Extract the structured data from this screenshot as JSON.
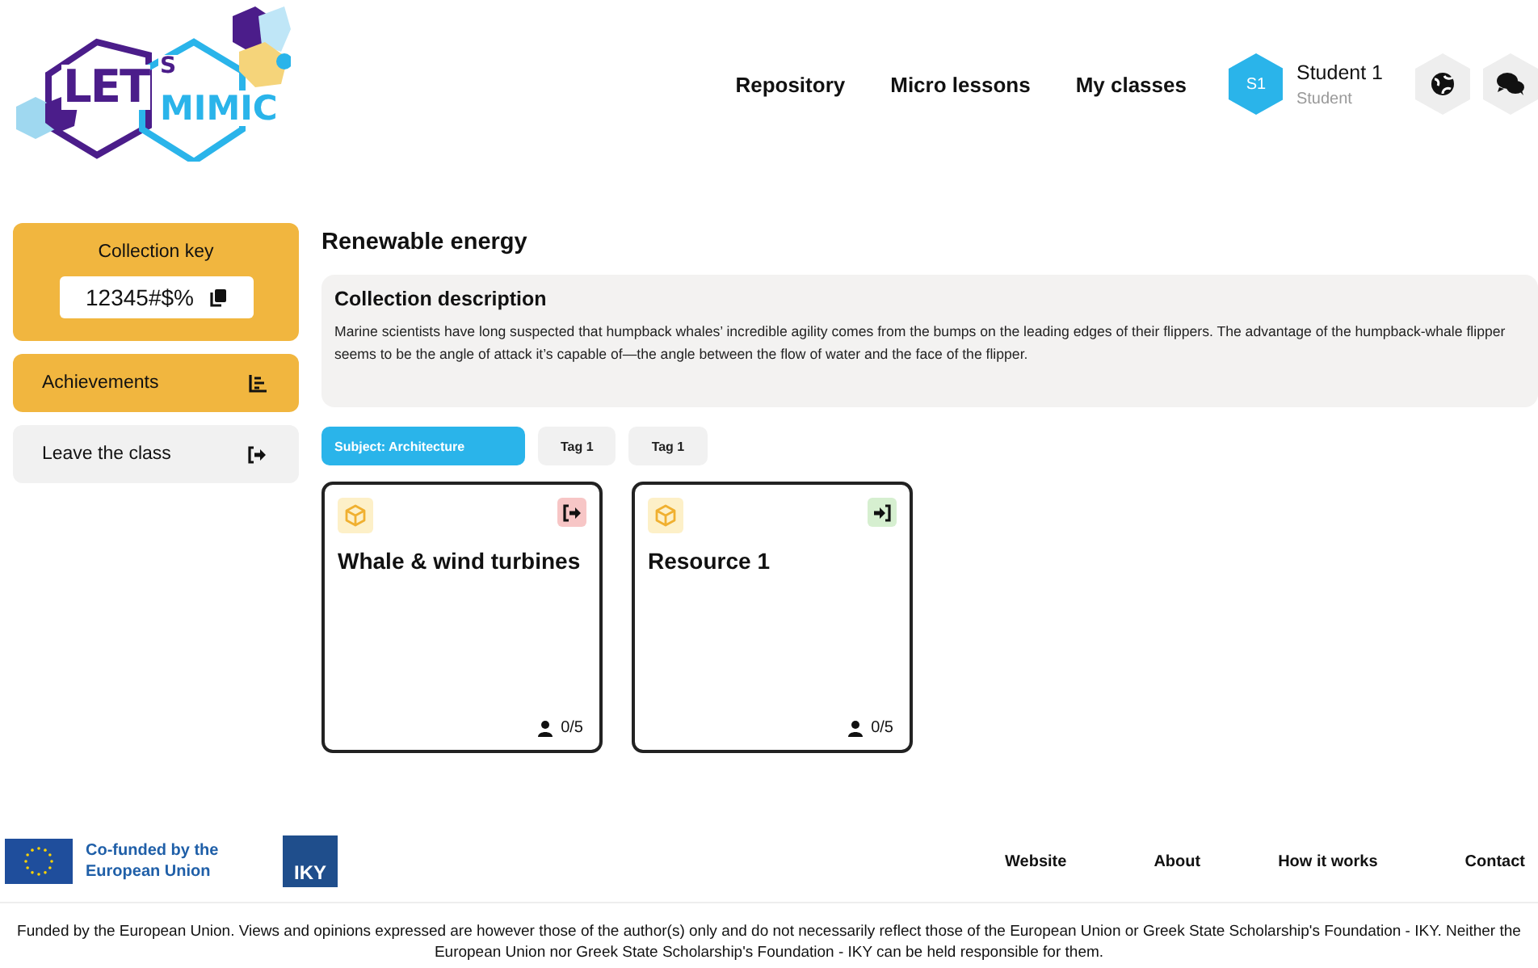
{
  "logo": {
    "word": "LET",
    "mark": "S",
    "word2": "MIMIC"
  },
  "nav": [
    "Repository",
    "Micro lessons",
    "My classes"
  ],
  "user": {
    "initials": "S1",
    "name": "Student 1",
    "role": "Student"
  },
  "sidebar": {
    "key_label": "Collection key",
    "key_value": "12345#$%",
    "items": [
      {
        "label": "Achievements",
        "kind": "chart",
        "selected": true
      },
      {
        "label": "Leave the class",
        "kind": "leave",
        "selected": false
      }
    ]
  },
  "collection": {
    "title": "Renewable energy",
    "description_title": "Collection description",
    "description": "Marine scientists have long suspected that humpback whales’ incredible agility comes from the bumps on the leading edges of their flippers. The advantage of the humpback-whale flipper seems to be the angle of attack it’s capable of—the angle between the flow of water and the face of the flipper.",
    "tags": [
      {
        "label": "Subject: Architecture",
        "selected": true
      },
      {
        "label": "Tag 1",
        "selected": false
      },
      {
        "label": "Tag 1",
        "selected": false
      }
    ],
    "cards": [
      {
        "title": "Whale & wind turbines",
        "kind": "leave",
        "count": "0/5"
      },
      {
        "title": "Resource 1",
        "kind": "join",
        "count": "0/5"
      }
    ]
  },
  "footer": {
    "eu": "Co-funded by the European Union",
    "iky": "IKY",
    "links": [
      "Website",
      "About",
      "How it works",
      "Contact"
    ],
    "disclaimer": "Funded by the European Union. Views and opinions expressed are however those of the author(s) only and do not necessarily reflect those of the European Union or Greek State Scholarship's Foundation - IKY. Neither the European Union nor Greek State Scholarship's Foundation - IKY can be held responsible for them."
  }
}
